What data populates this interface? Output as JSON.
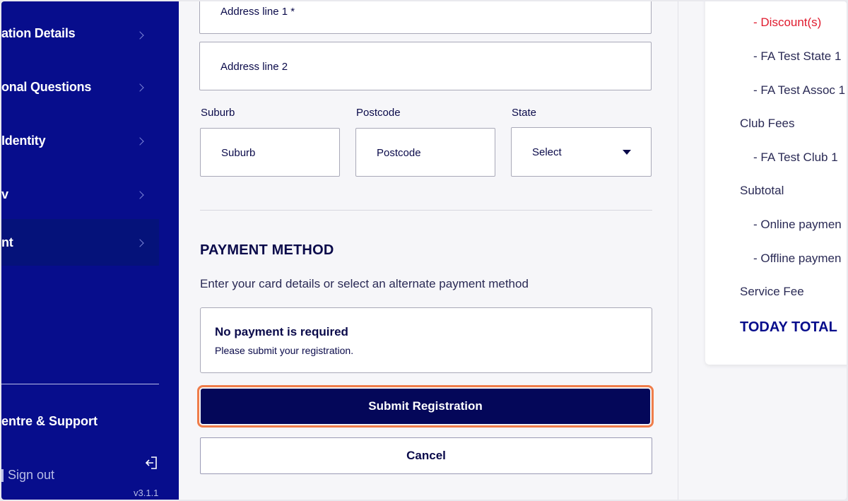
{
  "sidebar": {
    "items": [
      {
        "label": "ation Details"
      },
      {
        "label": "onal Questions"
      },
      {
        "label": "Identity"
      },
      {
        "label": "v"
      },
      {
        "label": "nt"
      }
    ],
    "help_label": "entre & Support",
    "signout_label": "Sign out",
    "version": "v3.1.1"
  },
  "form": {
    "address1": {
      "value": "Address line 1 *"
    },
    "address2": {
      "placeholder": "Address line 2"
    },
    "suburb": {
      "label": "Suburb",
      "placeholder": "Suburb"
    },
    "postcode": {
      "label": "Postcode",
      "placeholder": "Postcode"
    },
    "state": {
      "label": "State",
      "selected": "Select"
    }
  },
  "payment": {
    "title": "PAYMENT METHOD",
    "description": "Enter your card details or select an alternate payment method",
    "notice_title": "No payment is required",
    "notice_sub": "Please submit your registration.",
    "submit_label": "Submit Registration",
    "cancel_label": "Cancel"
  },
  "summary": {
    "discount": "- Discount(s)",
    "fa_state": "- FA Test State 1",
    "fa_assoc": "- FA Test Assoc 1",
    "club_fees": "Club Fees",
    "fa_club": "- FA Test Club 1",
    "subtotal": "Subtotal",
    "online_payment": "- Online paymen",
    "offline_payment": "- Offline paymen",
    "service_fee": "Service Fee",
    "today_total": "TODAY TOTAL"
  },
  "colors": {
    "sidebar_bg": "#070d8c",
    "primary_button": "#040759",
    "focus_ring": "#ef7d4a",
    "discount_red": "#e01b2e"
  }
}
